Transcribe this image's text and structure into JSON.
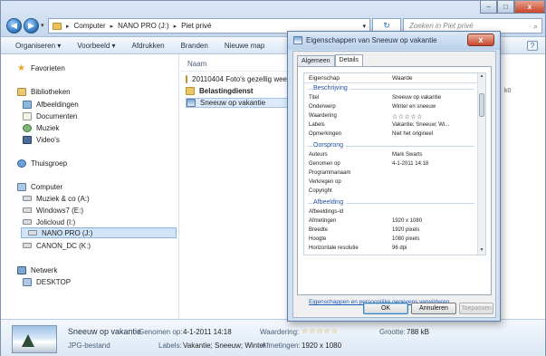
{
  "explorer": {
    "address": {
      "items": [
        "Computer",
        "NANO PRO (J:)",
        "Piet privé"
      ]
    },
    "search_placeholder": "Zoeken in Piet privé",
    "nav_back": "◀",
    "nav_forward": "▶",
    "refresh_glyph": "↻",
    "window_controls": {
      "minimize": "–",
      "maximize": "□",
      "close": "x"
    }
  },
  "toolbar": {
    "items": [
      "Organiseren ▾",
      "Voorbeeld ▾",
      "Afdrukken",
      "Branden",
      "Nieuwe map"
    ]
  },
  "sidebar": {
    "favorites": "Favorieten",
    "libraries": "Bibliotheken",
    "library_items": [
      "Afbeeldingen",
      "Documenten",
      "Muziek",
      "Video's"
    ],
    "homegroup": "Thuisgroep",
    "computer": "Computer",
    "drives": [
      "Muziek & co (A:)",
      "Windows7 (E:)",
      "Jolicloud (I:)",
      "NANO PRO (J:)",
      "CANON_DC (K:)"
    ],
    "network": "Netwerk",
    "network_items": [
      "DESKTOP"
    ]
  },
  "main": {
    "column_name": "Naam",
    "files": [
      {
        "name": "20110404 Foto's gezellig week",
        "type": "folder"
      },
      {
        "name": "Belastingdienst",
        "type": "folder"
      },
      {
        "name": "Sneeuw op vakantie",
        "type": "image"
      }
    ],
    "right_strip_size": "k0"
  },
  "details": {
    "filename": "Sneeuw op vakantie",
    "filetype": "JPG-bestand",
    "taken_label": "Genomen op:",
    "taken_value": "4-1-2011 14:18",
    "rating_label": "Waardering:",
    "rating_value": "☆☆☆☆☆",
    "size_label": "Grootte:",
    "size_value": "788 kB",
    "labels_label": "Labels:",
    "labels_value": "Vakantie; Sneeuw; Winter",
    "dims_label": "Afmetingen:",
    "dims_value": "1920 x 1080"
  },
  "dialog": {
    "title": "Eigenschappen van Sneeuw op vakantie",
    "close": "x",
    "tabs": [
      "Algemeen",
      "Details"
    ],
    "header_property": "Eigenschap",
    "header_value": "Waarde",
    "groups": [
      {
        "title": "Beschrijving",
        "rows": [
          {
            "k": "Titel",
            "v": "Sneeuw op vakantie"
          },
          {
            "k": "Onderwerp",
            "v": "Winter en sneeuw"
          },
          {
            "k": "Waardering",
            "v": "☆☆☆☆☆"
          },
          {
            "k": "Labels",
            "v": "Vakantie; Sneeuw; Wi..."
          },
          {
            "k": "Opmerkingen",
            "v": "Niet het origineel"
          }
        ]
      },
      {
        "title": "Oorsprong",
        "rows": [
          {
            "k": "Auteurs",
            "v": "Mark Swarts"
          },
          {
            "k": "Genomen op",
            "v": "4-1-2011 14:18"
          },
          {
            "k": "Programmanaam",
            "v": ""
          },
          {
            "k": "Verkregen op",
            "v": ""
          },
          {
            "k": "Copyright",
            "v": ""
          }
        ]
      },
      {
        "title": "Afbeelding",
        "rows": [
          {
            "k": "Afbeeldings-id",
            "v": ""
          },
          {
            "k": "Afmetingen",
            "v": "1920 x 1080"
          },
          {
            "k": "Breedte",
            "v": "1920 pixels"
          },
          {
            "k": "Hoogte",
            "v": "1080 pixels"
          },
          {
            "k": "Horizontale resolutie",
            "v": "96 dpi"
          }
        ]
      }
    ],
    "link": "Eigenschappen en persoonlijke gegevens verwijderen",
    "buttons": {
      "ok": "OK",
      "cancel": "Annuleren",
      "apply": "Toepassen"
    }
  }
}
